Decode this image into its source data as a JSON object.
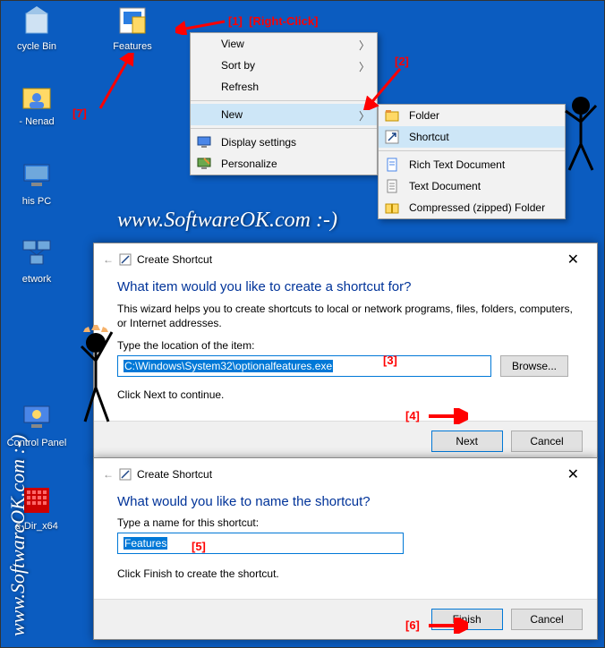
{
  "desktop": {
    "icons": [
      {
        "label": "cycle Bin"
      },
      {
        "label": "Features"
      },
      {
        "label": "- Nenad"
      },
      {
        "label": "his PC"
      },
      {
        "label": "etwork"
      },
      {
        "label": "Control Panel"
      },
      {
        "label": "e-Dir_x64"
      }
    ]
  },
  "context_menu": {
    "view": "View",
    "sortby": "Sort by",
    "refresh": "Refresh",
    "new": "New",
    "display": "Display settings",
    "personalize": "Personalize"
  },
  "submenu": {
    "folder": "Folder",
    "shortcut": "Shortcut",
    "rtf": "Rich Text Document",
    "txt": "Text Document",
    "zip": "Compressed (zipped) Folder"
  },
  "dialog1": {
    "window_title": "Create Shortcut",
    "title": "What item would you like to create a shortcut for?",
    "desc": "This wizard helps you to create shortcuts to local or network programs, files, folders, computers, or Internet addresses.",
    "loc_label": "Type the location of the item:",
    "loc_value": "C:\\Windows\\System32\\optionalfeatures.exe",
    "browse": "Browse...",
    "hint": "Click Next to continue.",
    "next": "Next",
    "cancel": "Cancel"
  },
  "dialog2": {
    "window_title": "Create Shortcut",
    "title": "What would you like to name the shortcut?",
    "name_label": "Type a name for this shortcut:",
    "name_value": "Features",
    "hint": "Click Finish to create the shortcut.",
    "finish": "Finish",
    "cancel": "Cancel"
  },
  "annotations": {
    "a1": "[1]",
    "a1b": "[Right-Click]",
    "a2": "[2]",
    "a3": "[3]",
    "a4": "[4]",
    "a5": "[5]",
    "a6": "[6]",
    "a7": "[7]"
  },
  "watermark": "www.SoftwareOK.com :-)",
  "watermark_v": "www.SoftwareOK.com :-)"
}
